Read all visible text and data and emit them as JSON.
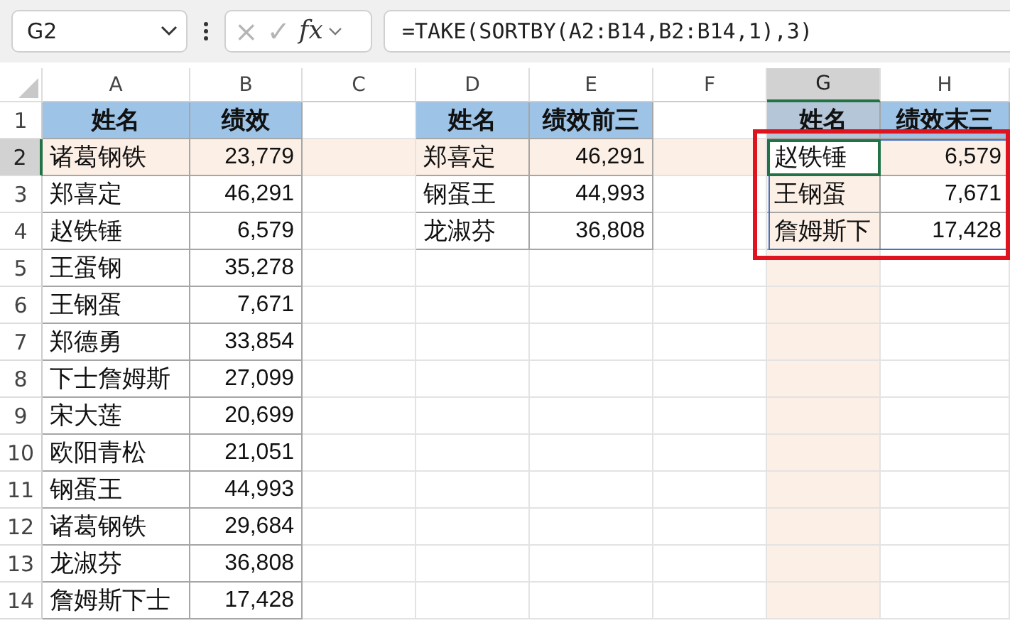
{
  "formula_bar": {
    "name_box": "G2",
    "cancel": "×",
    "enter": "✓",
    "function": "fx",
    "formula": "=TAKE(SORTBY(A2:B14,B2:B14,1),3)"
  },
  "columns": [
    {
      "label": "A",
      "selected": false
    },
    {
      "label": "B",
      "selected": false
    },
    {
      "label": "C",
      "selected": false
    },
    {
      "label": "D",
      "selected": false
    },
    {
      "label": "E",
      "selected": false
    },
    {
      "label": "F",
      "selected": false
    },
    {
      "label": "G",
      "selected": true
    },
    {
      "label": "H",
      "selected": false
    }
  ],
  "rows": [
    {
      "number": "1",
      "selected": false,
      "cells": [
        {
          "kind": "header",
          "text": "姓名"
        },
        {
          "kind": "header",
          "text": "绩效"
        },
        null,
        {
          "kind": "header",
          "text": "姓名"
        },
        {
          "kind": "header",
          "text": "绩效前三"
        },
        null,
        {
          "kind": "header",
          "text": "姓名"
        },
        {
          "kind": "header",
          "text": "绩效末三"
        }
      ]
    },
    {
      "number": "2",
      "selected": true,
      "cells": [
        {
          "kind": "text",
          "text": "诸葛钢铁"
        },
        {
          "kind": "number",
          "text": "23,779"
        },
        null,
        {
          "kind": "text",
          "text": "郑喜定"
        },
        {
          "kind": "number",
          "text": "46,291"
        },
        null,
        {
          "kind": "text",
          "text": "赵铁锤",
          "active": true
        },
        {
          "kind": "number",
          "text": "6,579"
        }
      ]
    },
    {
      "number": "3",
      "selected": false,
      "cells": [
        {
          "kind": "text",
          "text": "郑喜定"
        },
        {
          "kind": "number",
          "text": "46,291"
        },
        null,
        {
          "kind": "text",
          "text": "钢蛋王"
        },
        {
          "kind": "number",
          "text": "44,993"
        },
        null,
        {
          "kind": "text",
          "text": "王钢蛋"
        },
        {
          "kind": "number",
          "text": "7,671"
        }
      ]
    },
    {
      "number": "4",
      "selected": false,
      "cells": [
        {
          "kind": "text",
          "text": "赵铁锤"
        },
        {
          "kind": "number",
          "text": "6,579"
        },
        null,
        {
          "kind": "text",
          "text": "龙淑芬"
        },
        {
          "kind": "number",
          "text": "36,808"
        },
        null,
        {
          "kind": "text",
          "text": "詹姆斯下"
        },
        {
          "kind": "number",
          "text": "17,428"
        }
      ]
    },
    {
      "number": "5",
      "selected": false,
      "cells": [
        {
          "kind": "text",
          "text": "王蛋钢"
        },
        {
          "kind": "number",
          "text": "35,278"
        },
        null,
        null,
        null,
        null,
        null,
        null
      ]
    },
    {
      "number": "6",
      "selected": false,
      "cells": [
        {
          "kind": "text",
          "text": "王钢蛋"
        },
        {
          "kind": "number",
          "text": "7,671"
        },
        null,
        null,
        null,
        null,
        null,
        null
      ]
    },
    {
      "number": "7",
      "selected": false,
      "cells": [
        {
          "kind": "text",
          "text": "郑德勇"
        },
        {
          "kind": "number",
          "text": "33,854"
        },
        null,
        null,
        null,
        null,
        null,
        null
      ]
    },
    {
      "number": "8",
      "selected": false,
      "cells": [
        {
          "kind": "text",
          "text": "下士詹姆斯"
        },
        {
          "kind": "number",
          "text": "27,099"
        },
        null,
        null,
        null,
        null,
        null,
        null
      ]
    },
    {
      "number": "9",
      "selected": false,
      "cells": [
        {
          "kind": "text",
          "text": "宋大莲"
        },
        {
          "kind": "number",
          "text": "20,699"
        },
        null,
        null,
        null,
        null,
        null,
        null
      ]
    },
    {
      "number": "10",
      "selected": false,
      "cells": [
        {
          "kind": "text",
          "text": "欧阳青松"
        },
        {
          "kind": "number",
          "text": "21,051"
        },
        null,
        null,
        null,
        null,
        null,
        null
      ]
    },
    {
      "number": "11",
      "selected": false,
      "cells": [
        {
          "kind": "text",
          "text": "钢蛋王"
        },
        {
          "kind": "number",
          "text": "44,993"
        },
        null,
        null,
        null,
        null,
        null,
        null
      ]
    },
    {
      "number": "12",
      "selected": false,
      "cells": [
        {
          "kind": "text",
          "text": "诸葛钢铁"
        },
        {
          "kind": "number",
          "text": "29,684"
        },
        null,
        null,
        null,
        null,
        null,
        null
      ]
    },
    {
      "number": "13",
      "selected": false,
      "cells": [
        {
          "kind": "text",
          "text": "龙淑芬"
        },
        {
          "kind": "number",
          "text": "36,808"
        },
        null,
        null,
        null,
        null,
        null,
        null
      ]
    },
    {
      "number": "14",
      "selected": false,
      "cells": [
        {
          "kind": "text",
          "text": "詹姆斯下士"
        },
        {
          "kind": "number",
          "text": "17,428"
        },
        null,
        null,
        null,
        null,
        null,
        null
      ]
    }
  ]
}
